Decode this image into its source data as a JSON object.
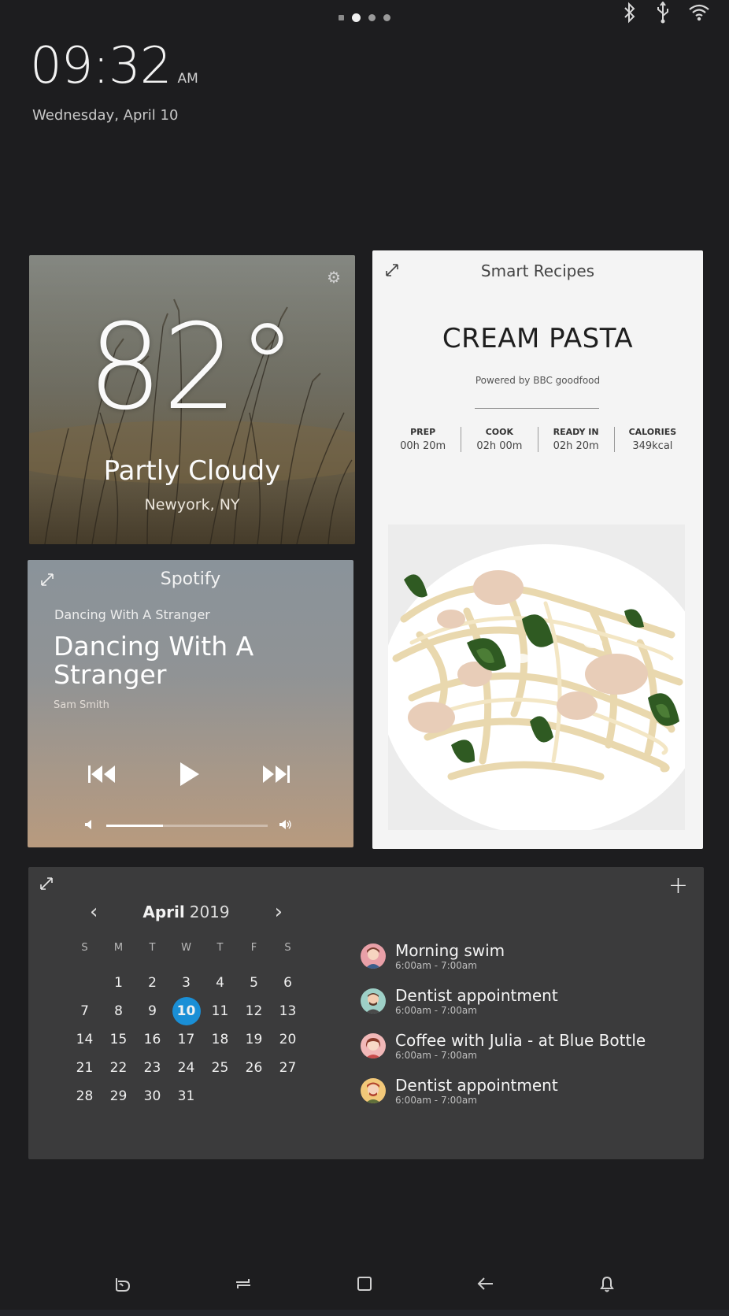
{
  "status": {
    "page_dots": 4,
    "active_page": 1,
    "icons": [
      "bluetooth-icon",
      "usb-icon",
      "wifi-icon"
    ]
  },
  "clock": {
    "time": "09:32",
    "ampm": "AM",
    "date": "Wednesday, April 10"
  },
  "weather": {
    "temperature": "82°",
    "condition": "Partly Cloudy",
    "location": "Newyork, NY"
  },
  "spotify": {
    "app_name": "Spotify",
    "subtitle": "Dancing With A Stranger",
    "song_title": "Dancing With A Stranger",
    "artist": "Sam Smith",
    "volume": 0.35
  },
  "recipes": {
    "app_name": "Smart Recipes",
    "dish": "CREAM PASTA",
    "powered_by": "Powered by BBC goodfood",
    "stats": [
      {
        "label": "PREP",
        "value": "00h 20m"
      },
      {
        "label": "COOK",
        "value": "02h 00m"
      },
      {
        "label": "READY IN",
        "value": "02h 20m"
      },
      {
        "label": "CALORIES",
        "value": "349kcal"
      }
    ]
  },
  "calendar": {
    "month": "April",
    "year": "2019",
    "weekdays": [
      "S",
      "M",
      "T",
      "W",
      "T",
      "F",
      "S"
    ],
    "first_weekday": 1,
    "days_in_month": 31,
    "today": 10,
    "today_color": "#1a8fd6",
    "events": [
      {
        "title": "Morning swim",
        "time": "6:00am - 7:00am",
        "avatar_color": "#e9a0a8"
      },
      {
        "title": "Dentist appointment",
        "time": "6:00am - 7:00am",
        "avatar_color": "#9ed0c7"
      },
      {
        "title": "Coffee with Julia - at Blue Bottle",
        "time": "6:00am - 7:00am",
        "avatar_color": "#f1b8b8"
      },
      {
        "title": "Dentist appointment",
        "time": "6:00am - 7:00am",
        "avatar_color": "#f2c879"
      }
    ]
  },
  "navbar": {
    "icons": [
      "bixby-icon",
      "recent-apps-icon",
      "home-icon",
      "back-icon",
      "notification-icon"
    ]
  }
}
